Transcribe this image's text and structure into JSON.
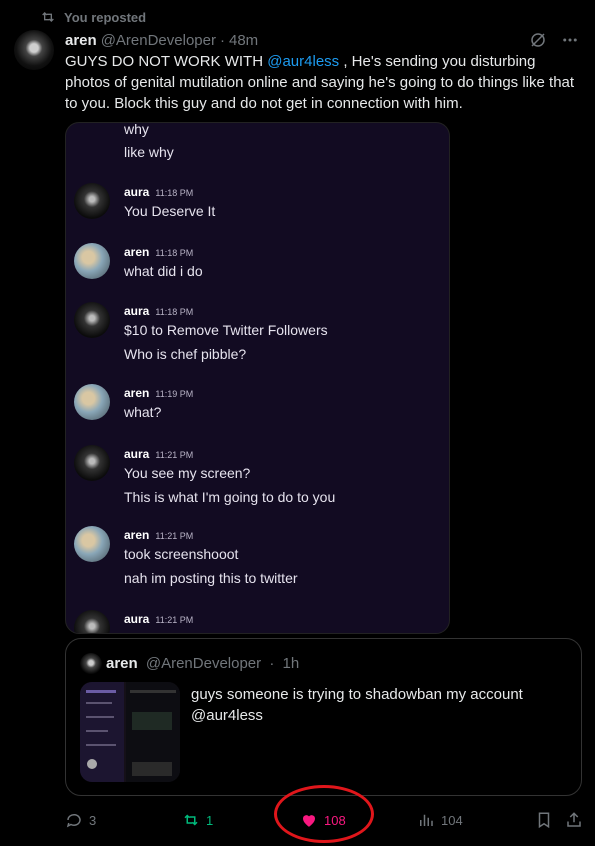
{
  "repost": {
    "label": "You reposted",
    "icon": "repost-icon"
  },
  "post": {
    "author_name": "aren",
    "author_handle": "@ArenDeveloper",
    "separator": "·",
    "time": "48m",
    "text_before": "GUYS DO NOT WORK WITH ",
    "mention": "@aur4less",
    "text_after": " , He's sending you disturbing photos of genital mutilation online and saying he's going to do things like that to you. Block this guy and do not get in connection with him."
  },
  "chat": {
    "top_lines": [
      "why",
      "like why"
    ],
    "messages": [
      {
        "user": "aura",
        "time": "11:18 PM",
        "lines": [
          "You Deserve It"
        ]
      },
      {
        "user": "aren",
        "time": "11:18 PM",
        "lines": [
          "what did i do"
        ]
      },
      {
        "user": "aura",
        "time": "11:18 PM",
        "lines": [
          "$10 to Remove Twitter Followers",
          "Who is chef pibble?"
        ]
      },
      {
        "user": "aren",
        "time": "11:19 PM",
        "lines": [
          "what?"
        ]
      },
      {
        "user": "aura",
        "time": "11:21 PM",
        "lines": [
          "You see my screen?",
          "This is what I'm going to do to you"
        ]
      },
      {
        "user": "aren",
        "time": "11:21 PM",
        "lines": [
          "took screenshooot",
          "nah im posting this to twitter"
        ]
      },
      {
        "user": "aura",
        "time": "11:21 PM",
        "lines": []
      }
    ]
  },
  "quote": {
    "author_name": "aren",
    "author_handle": "@ArenDeveloper",
    "separator": "·",
    "time": "1h",
    "text": "guys someone is trying to shadowban my account @aur4less"
  },
  "actions": {
    "replies": "3",
    "reposts": "1",
    "likes": "108",
    "views": "104"
  },
  "colors": {
    "accent": "#1d9bf0",
    "like": "#f91880",
    "repost": "#00ba7c",
    "annotation": "#e0161b"
  }
}
